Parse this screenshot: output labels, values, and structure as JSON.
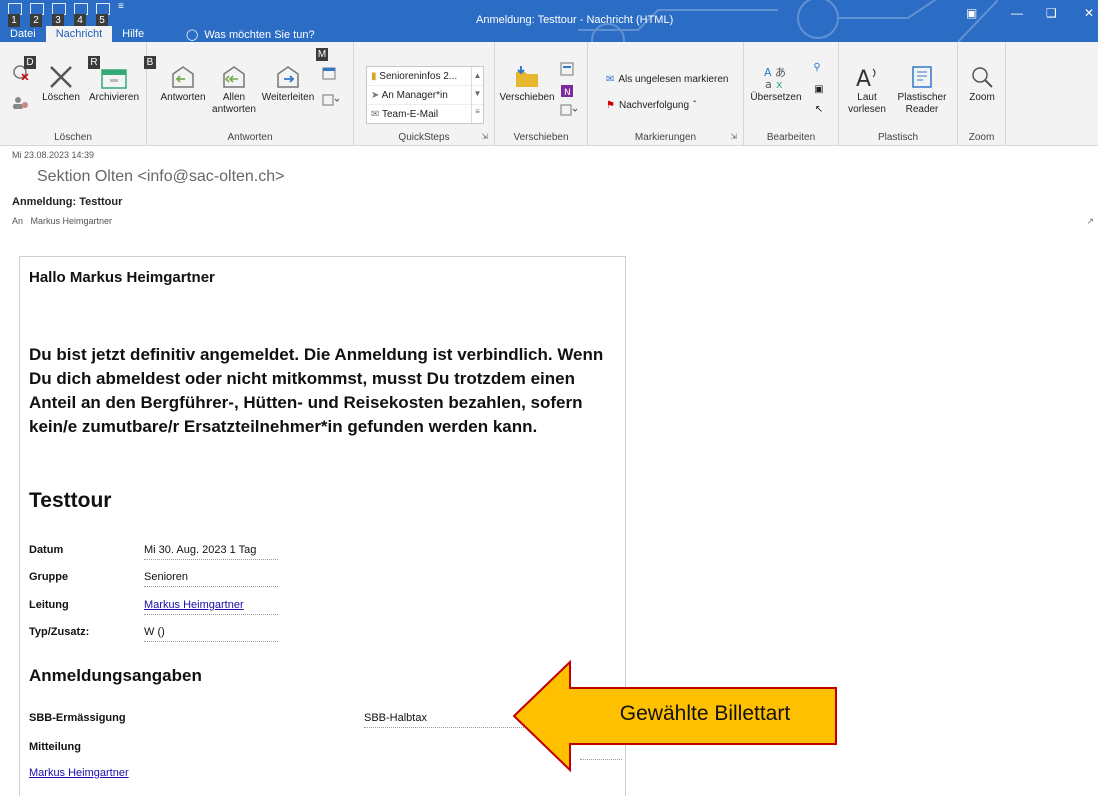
{
  "window": {
    "title": "Anmeldung: Testtour  -  Nachricht (HTML)",
    "qat_keytips": [
      "1",
      "2",
      "3",
      "4",
      "5"
    ]
  },
  "tabs": [
    {
      "label": "Datei",
      "keytip": "D"
    },
    {
      "label": "Nachricht",
      "keytip": "R"
    },
    {
      "label": "Hilfe",
      "keytip": "B"
    }
  ],
  "tellme": {
    "label": "Was möchten Sie tun?",
    "keytip": "M"
  },
  "ribbon": {
    "groups": {
      "loeschen": "Löschen",
      "antworten": "Antworten",
      "quicksteps": "QuickSteps",
      "verschieben": "Verschieben",
      "markierungen": "Markierungen",
      "bearbeiten": "Bearbeiten",
      "plastisch": "Plastisch",
      "zoom": "Zoom"
    },
    "buttons": {
      "loeschen": "Löschen",
      "archivieren": "Archivieren",
      "antworten": "Antworten",
      "allen_antworten_1": "Allen",
      "allen_antworten_2": "antworten",
      "weiterleiten": "Weiterleiten",
      "verschieben": "Verschieben",
      "als_ungelesen": "Als ungelesen markieren",
      "nachverfolgung": "Nachverfolgung",
      "uebersetzen": "Übersetzen",
      "laut_1": "Laut",
      "laut_2": "vorlesen",
      "reader_1": "Plastischer",
      "reader_2": "Reader",
      "zoom": "Zoom"
    },
    "quicksteps": [
      "Senioreninfos 2...",
      "An Manager*in",
      "Team-E-Mail"
    ]
  },
  "message": {
    "date": "Mi 23.08.2023 14:39",
    "sender": "Sektion Olten <info@sac-olten.ch>",
    "subject": "Anmeldung: Testtour",
    "to_label": "An",
    "to": "Markus Heimgartner"
  },
  "body": {
    "greeting": "Hallo Markus Heimgartner",
    "paragraph": "Du bist jetzt definitiv angemeldet. Die Anmeldung ist verbindlich. Wenn Du dich abmeldest oder nicht mitkommst, musst Du trotzdem einen Anteil an den Bergführer-, Hütten- und Reisekosten bezahlen, sofern kein/e zumutbare/r Ersatzteilnehmer*in gefunden werden kann.",
    "tour_title": "Testtour",
    "details": [
      {
        "label": "Datum",
        "value": "Mi 30. Aug. 2023 1 Tag"
      },
      {
        "label": "Gruppe",
        "value": "Senioren"
      },
      {
        "label": "Leitung",
        "value": "Markus Heimgartner"
      },
      {
        "label": "Typ/Zusatz:",
        "value": "W ()"
      }
    ],
    "anmeldungsangaben": "Anmeldungsangaben",
    "sbb_label": "SBB-Ermässigung",
    "sbb_value": "SBB-Halbtax",
    "mitteilung_label": "Mitteilung",
    "footer_link": "Markus Heimgartner"
  },
  "annotation": {
    "text": "Gewählte Billettart",
    "fill": "#ffc000",
    "stroke": "#c00000"
  },
  "colors": {
    "accent": "#2b6cc4",
    "link": "#1a0dab"
  }
}
